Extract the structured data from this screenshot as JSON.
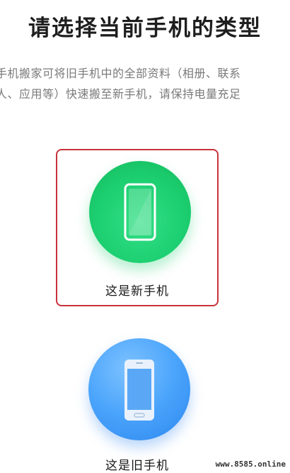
{
  "page": {
    "title": "请选择当前手机的类型",
    "description_line1": "手机搬家可将旧手机中的全部资料（相册、联系",
    "description_line2": "人、应用等）快速搬至新手机，请保持电量充足"
  },
  "options": [
    {
      "label": "这是新手机",
      "icon": "phone-icon",
      "color": "#1ccf70",
      "selected": true
    },
    {
      "label": "这是旧手机",
      "icon": "phone-icon",
      "color": "#4aa4fb",
      "selected": false
    }
  ],
  "colors": {
    "selection_border": "#c8333c",
    "new_phone": "#1ccf70",
    "old_phone": "#4aa4fb"
  },
  "watermark": "www.8585.online"
}
